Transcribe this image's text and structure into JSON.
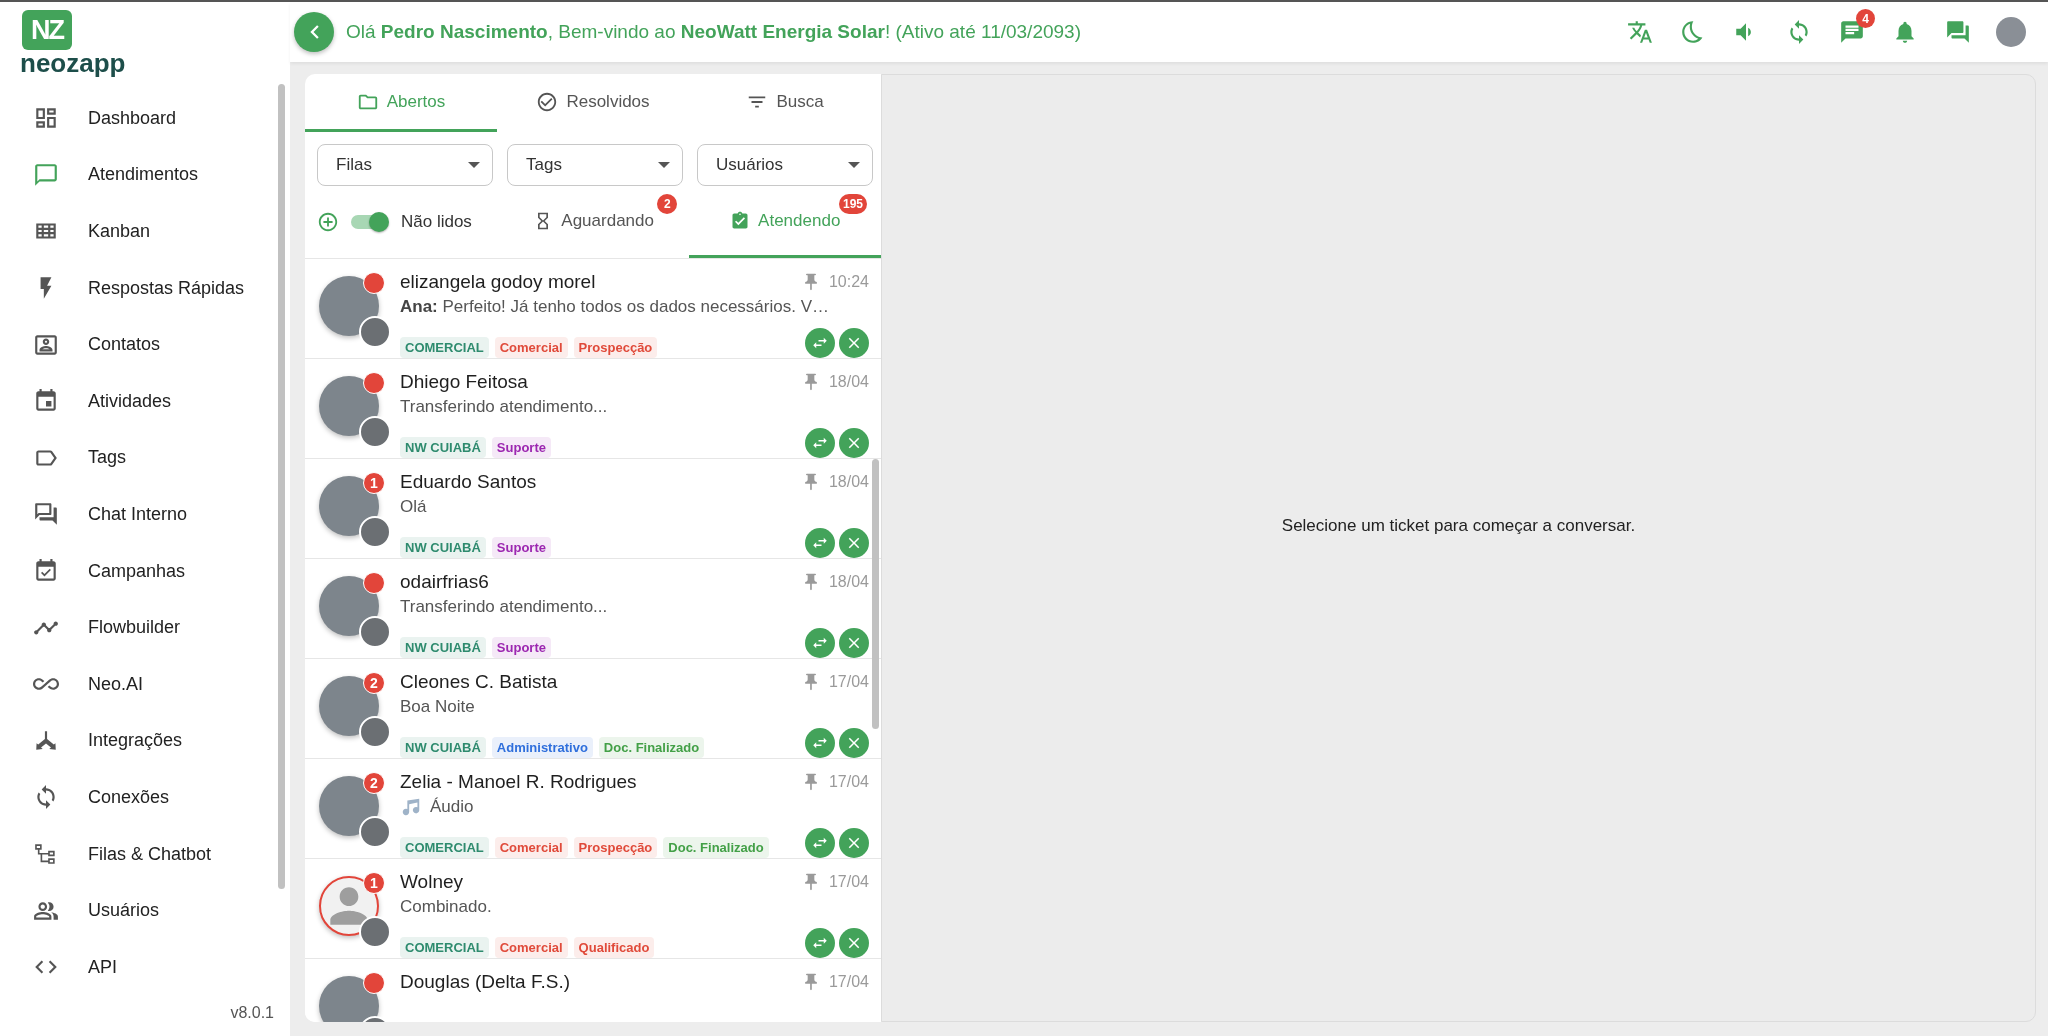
{
  "sidebar": {
    "logo_mark": "NZ",
    "logo_text": "neozapp",
    "items": [
      {
        "label": "Dashboard",
        "kind": "dashboard",
        "selected": false
      },
      {
        "label": "Atendimentos",
        "kind": "chat",
        "selected": true
      },
      {
        "label": "Kanban",
        "kind": "grid",
        "selected": false
      },
      {
        "label": "Respostas Rápidas",
        "kind": "bolt",
        "selected": false
      },
      {
        "label": "Contatos",
        "kind": "contact",
        "selected": false
      },
      {
        "label": "Atividades",
        "kind": "calendar",
        "selected": false
      },
      {
        "label": "Tags",
        "kind": "tag",
        "selected": false
      },
      {
        "label": "Chat Interno",
        "kind": "forum",
        "selected": false
      },
      {
        "label": "Campanhas",
        "kind": "calendar-check",
        "selected": false
      },
      {
        "label": "Flowbuilder",
        "kind": "timeline",
        "selected": false
      },
      {
        "label": "Neo.AI",
        "kind": "infinity",
        "selected": false
      },
      {
        "label": "Integrações",
        "kind": "branch",
        "selected": false
      },
      {
        "label": "Conexões",
        "kind": "sync",
        "selected": false
      },
      {
        "label": "Filas & Chatbot",
        "kind": "tree",
        "selected": false
      },
      {
        "label": "Usuários",
        "kind": "users",
        "selected": false
      },
      {
        "label": "API",
        "kind": "code",
        "selected": false
      }
    ],
    "version": "v8.0.1"
  },
  "header": {
    "greeting": "Olá **Pedro Nascimento**, Bem-vindo ao **NeoWatt Energia Solar**! (Ativo até 11/03/2093)",
    "icons": [
      {
        "kind": "translate"
      },
      {
        "kind": "moon"
      },
      {
        "kind": "volume"
      },
      {
        "kind": "sync"
      },
      {
        "kind": "messages",
        "badge": "4"
      },
      {
        "kind": "bell"
      },
      {
        "kind": "forum"
      },
      {
        "kind": "avatar"
      }
    ]
  },
  "tickets_panel": {
    "tabs": [
      {
        "label": "Abertos",
        "kind": "folder",
        "selected": true
      },
      {
        "label": "Resolvidos",
        "kind": "check",
        "selected": false
      },
      {
        "label": "Busca",
        "kind": "filter",
        "selected": false
      }
    ],
    "filters": [
      {
        "label": "Filas"
      },
      {
        "label": "Tags"
      },
      {
        "label": "Usuários"
      }
    ],
    "unread_toggle": {
      "label": "Não lidos",
      "on": true
    },
    "status_tabs": [
      {
        "label": "Aguardando",
        "kind": "hourglass",
        "badge": "2",
        "selected": false
      },
      {
        "label": "Atendendo",
        "kind": "clipboard",
        "badge": "195",
        "selected": true
      }
    ],
    "tickets": [
      {
        "name": "elizangela godoy morel",
        "time": "10:24",
        "pinned": true,
        "unread": true,
        "kind": "photo",
        "preview": "**Ana:** Perfeito! Já tenho todos os dados necessários. V…",
        "tags": [
          {
            "label": "COMERCIAL",
            "color": "#2e8b6e"
          },
          {
            "label": "Comercial",
            "color": "#e04a3a"
          },
          {
            "label": "Prospecção",
            "color": "#e04a3a"
          }
        ]
      },
      {
        "name": "Dhiego Feitosa",
        "time": "18/04",
        "pinned": true,
        "unread": true,
        "kind": "photo",
        "preview": "Transferindo atendimento...",
        "tags": [
          {
            "label": "NW CUIABÁ",
            "color": "#2e8b6e"
          },
          {
            "label": "Suporte",
            "color": "#9c27b0"
          }
        ]
      },
      {
        "name": "Eduardo Santos",
        "time": "18/04",
        "pinned": true,
        "unread": true,
        "unread_count": "1",
        "kind": "photo",
        "preview": "Olá",
        "tags": [
          {
            "label": "NW CUIABÁ",
            "color": "#2e8b6e"
          },
          {
            "label": "Suporte",
            "color": "#9c27b0"
          }
        ]
      },
      {
        "name": "odairfrias6",
        "time": "18/04",
        "pinned": true,
        "unread": true,
        "kind": "photo",
        "preview": "Transferindo atendimento...",
        "tags": [
          {
            "label": "NW CUIABÁ",
            "color": "#2e8b6e"
          },
          {
            "label": "Suporte",
            "color": "#9c27b0"
          }
        ]
      },
      {
        "name": "Cleones C. Batista",
        "time": "17/04",
        "pinned": true,
        "unread": true,
        "unread_count": "2",
        "kind": "photo",
        "preview": "Boa Noite",
        "tags": [
          {
            "label": "NW CUIABÁ",
            "color": "#2e8b6e"
          },
          {
            "label": "Administrativo",
            "color": "#2f6fdc"
          },
          {
            "label": "Doc. Finalizado",
            "color": "#43a047"
          }
        ]
      },
      {
        "name": "Zelia - Manoel R. Rodrigues",
        "time": "17/04",
        "pinned": true,
        "unread": true,
        "unread_count": "2",
        "kind": "photo",
        "preview": {
          "kind": "audio",
          "text": "Áudio"
        },
        "tags": [
          {
            "label": "COMERCIAL",
            "color": "#2e8b6e"
          },
          {
            "label": "Comercial",
            "color": "#e04a3a"
          },
          {
            "label": "Prospecção",
            "color": "#e04a3a"
          },
          {
            "label": "Doc. Finalizado",
            "color": "#43a047"
          }
        ]
      },
      {
        "name": "Wolney",
        "time": "17/04",
        "pinned": true,
        "unread": true,
        "unread_count": "1",
        "kind": "default",
        "preview": "Combinado.",
        "tags": [
          {
            "label": "COMERCIAL",
            "color": "#2e8b6e"
          },
          {
            "label": "Comercial",
            "color": "#e04a3a"
          },
          {
            "label": "Qualificado",
            "color": "#e04a3a"
          }
        ]
      },
      {
        "name": "Douglas (Delta F.S.)",
        "time": "17/04",
        "pinned": true,
        "unread": true,
        "kind": "photo"
      }
    ]
  },
  "chat_area": {
    "message": "Selecione um ticket para começar a conversar."
  }
}
